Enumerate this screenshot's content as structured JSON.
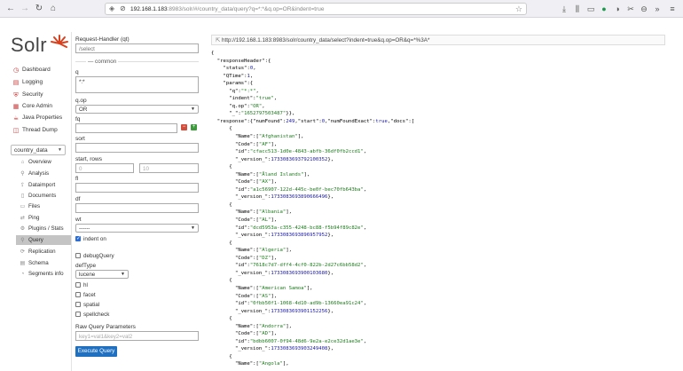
{
  "browser": {
    "url_host": "192.168.1.183",
    "url_rest": ":8983/solr/#/country_data/query?q=*:*&q.op=OR&indent=true"
  },
  "sidebar": {
    "logo_text": "Solr",
    "items": [
      {
        "label": "Dashboard",
        "icon": "dashboard-icon"
      },
      {
        "label": "Logging",
        "icon": "logging-icon"
      },
      {
        "label": "Security",
        "icon": "security-icon"
      },
      {
        "label": "Core Admin",
        "icon": "core-admin-icon"
      },
      {
        "label": "Java Properties",
        "icon": "java-icon"
      },
      {
        "label": "Thread Dump",
        "icon": "thread-icon"
      }
    ],
    "core_selector": "country_data",
    "core_items": [
      {
        "label": "Overview"
      },
      {
        "label": "Analysis"
      },
      {
        "label": "Dataimport"
      },
      {
        "label": "Documents"
      },
      {
        "label": "Files"
      },
      {
        "label": "Ping"
      },
      {
        "label": "Plugins / Stats"
      },
      {
        "label": "Query"
      },
      {
        "label": "Replication"
      },
      {
        "label": "Schema"
      },
      {
        "label": "Segments info"
      }
    ]
  },
  "form": {
    "request_handler_label": "Request-Handler (qt)",
    "request_handler_value": "/select",
    "common_label": "common",
    "q_label": "q",
    "q_value": "*:*",
    "qop_label": "q.op",
    "qop_value": "OR",
    "fq_label": "fq",
    "sort_label": "sort",
    "start_rows_label": "start, rows",
    "start_placeholder": "0",
    "rows_placeholder": "10",
    "fl_label": "fl",
    "df_label": "df",
    "wt_label": "wt",
    "wt_value": "------",
    "indent_label": "indent on",
    "debug_label": "debugQuery",
    "deftype_label": "defType",
    "deftype_value": "lucene",
    "hl_label": "hl",
    "facet_label": "facet",
    "spatial_label": "spatial",
    "spellcheck_label": "spellcheck",
    "raw_label": "Raw Query Parameters",
    "raw_placeholder": "key1=val1&key2=val2",
    "execute_label": "Execute Query"
  },
  "results": {
    "request_url": "http://192.168.1.183:8983/solr/country_data/select?indent=true&q.op=OR&q=*%3A*",
    "header": {
      "status": "0",
      "qtime": "1",
      "q": "\"*:*\"",
      "indent": "\"true\"",
      "qop": "\"OR\"",
      "underscore": "\"1652797503487\""
    },
    "response_meta": {
      "numFound": "249",
      "start": "0",
      "numFoundExact": "true"
    },
    "docs": [
      {
        "name": "\"Afghanistan\"",
        "code": "\"AF\"",
        "id": "\"cfacc513-1d0e-4843-abfb-36df0fb2ccd1\"",
        "version": "1733083693792100352"
      },
      {
        "name": "\"Åland Islands\"",
        "code": "\"AX\"",
        "id": "\"a1c56907-122d-445c-be0f-bec70fb643ba\"",
        "version": "1733083693890666496"
      },
      {
        "name": "\"Albania\"",
        "code": "\"AL\"",
        "id": "\"dcd5953a-c355-4248-bc88-f5b94f89c82e\"",
        "version": "1733083693896957952"
      },
      {
        "name": "\"Algeria\"",
        "code": "\"DZ\"",
        "id": "\"7618c7d7-dff4-4cf0-822b-2d27c6bb58d2\"",
        "version": "1733083693900103680"
      },
      {
        "name": "\"American Samoa\"",
        "code": "\"AS\"",
        "id": "\"0fbb50f1-1068-4d10-ad9b-13660ea91c24\"",
        "version": "1733083693901152256"
      },
      {
        "name": "\"Andorra\"",
        "code": "\"AD\"",
        "id": "\"bdbb6007-0f94-48d6-9e2a-e2ce32d1ae3e\"",
        "version": "1733083693903249408"
      },
      {
        "name": "\"Angola\""
      }
    ]
  }
}
